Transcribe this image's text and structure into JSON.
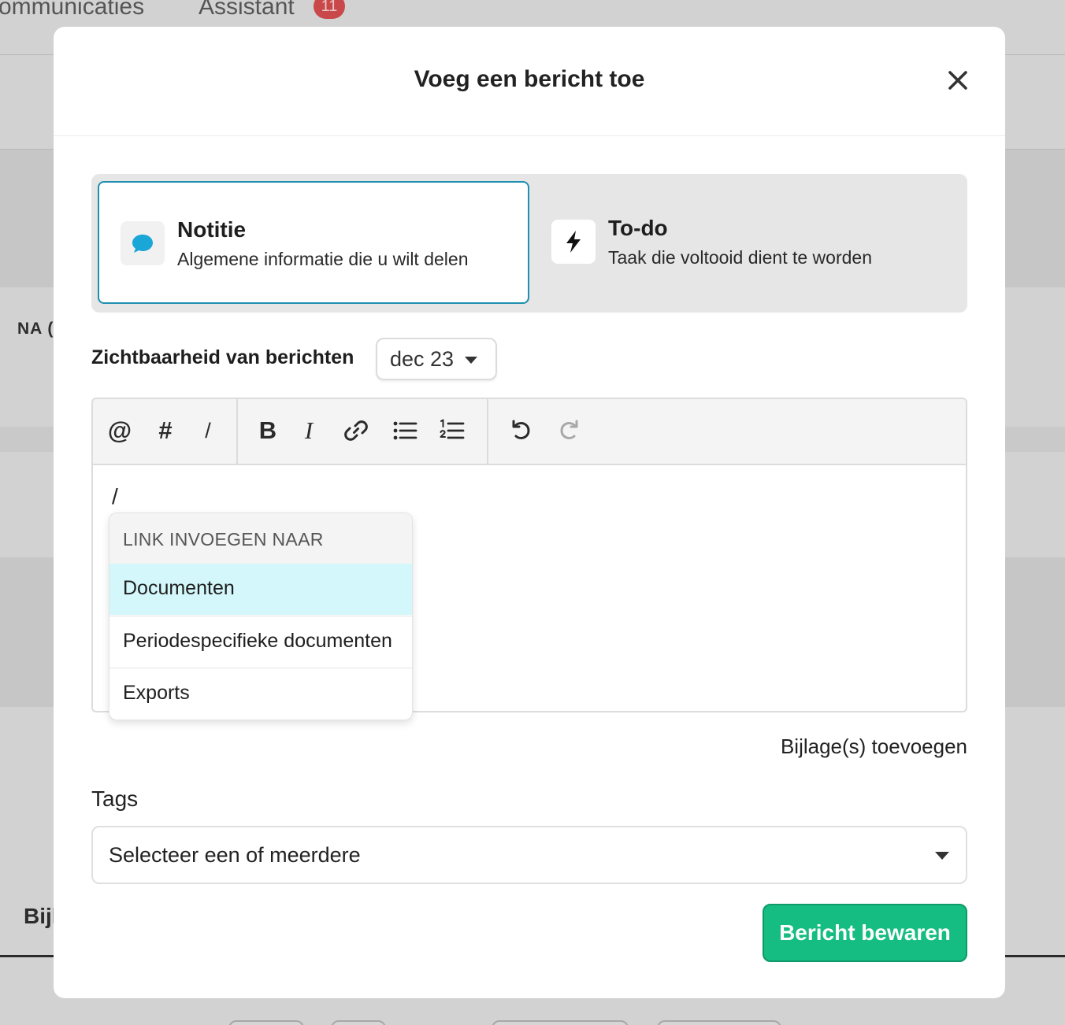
{
  "background": {
    "tabs": [
      "ommunicaties",
      "Assistant"
    ],
    "assistant_badge": "11",
    "partial_text_na": "NA (",
    "partial_text_bij": "Bijl"
  },
  "modal": {
    "title": "Voeg een bericht toe",
    "close_icon": "close-icon"
  },
  "message_types": [
    {
      "label": "Notitie",
      "description": "Algemene informatie die u wilt delen",
      "icon": "speech-bubble-icon",
      "selected": true,
      "icon_color": "#1aa6d6"
    },
    {
      "label": "To-do",
      "description": "Taak die voltooid dient te worden",
      "icon": "lightning-icon",
      "selected": false
    }
  ],
  "visibility": {
    "label": "Zichtbaarheid van berichten",
    "value": "dec 23"
  },
  "editor": {
    "toolbar": {
      "mention": "@",
      "hashtag": "#",
      "slash": "/",
      "bold": "B",
      "italic": "I"
    },
    "content": "/"
  },
  "link_dropdown": {
    "header": "LINK INVOEGEN NAAR",
    "items": [
      "Documenten",
      "Periodespecifieke documenten",
      "Exports"
    ],
    "active_index": 0
  },
  "attachments": {
    "label": "Bijlage(s) toevoegen"
  },
  "tags": {
    "label": "Tags",
    "placeholder": "Selecteer een of meerdere"
  },
  "save": {
    "label": "Bericht bewaren",
    "color": "#16bd83"
  }
}
